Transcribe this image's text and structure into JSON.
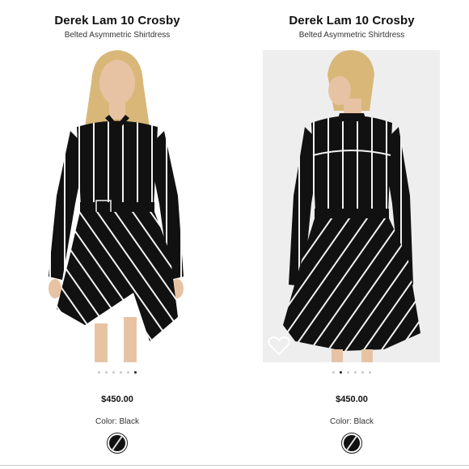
{
  "products": [
    {
      "brand": "Derek Lam 10 Crosby",
      "subtitle": "Belted Asymmetric Shirtdress",
      "price": "$450.00",
      "color_label": "Color: Black",
      "carousel": {
        "total": 6,
        "active_index": 5
      }
    },
    {
      "brand": "Derek Lam 10 Crosby",
      "subtitle": "Belted Asymmetric Shirtdress",
      "price": "$450.00",
      "color_label": "Color: Black",
      "carousel": {
        "total": 6,
        "active_index": 1
      }
    }
  ],
  "icons": {
    "favorite": "heart-outline-icon",
    "swatch": "black-striped-swatch-icon"
  },
  "colors": {
    "dress": "#111111",
    "stripe": "#f2f2f2",
    "skin": "#e7c3a4",
    "hair": "#d8b779",
    "photo_bg_right": "#eeeeee"
  }
}
